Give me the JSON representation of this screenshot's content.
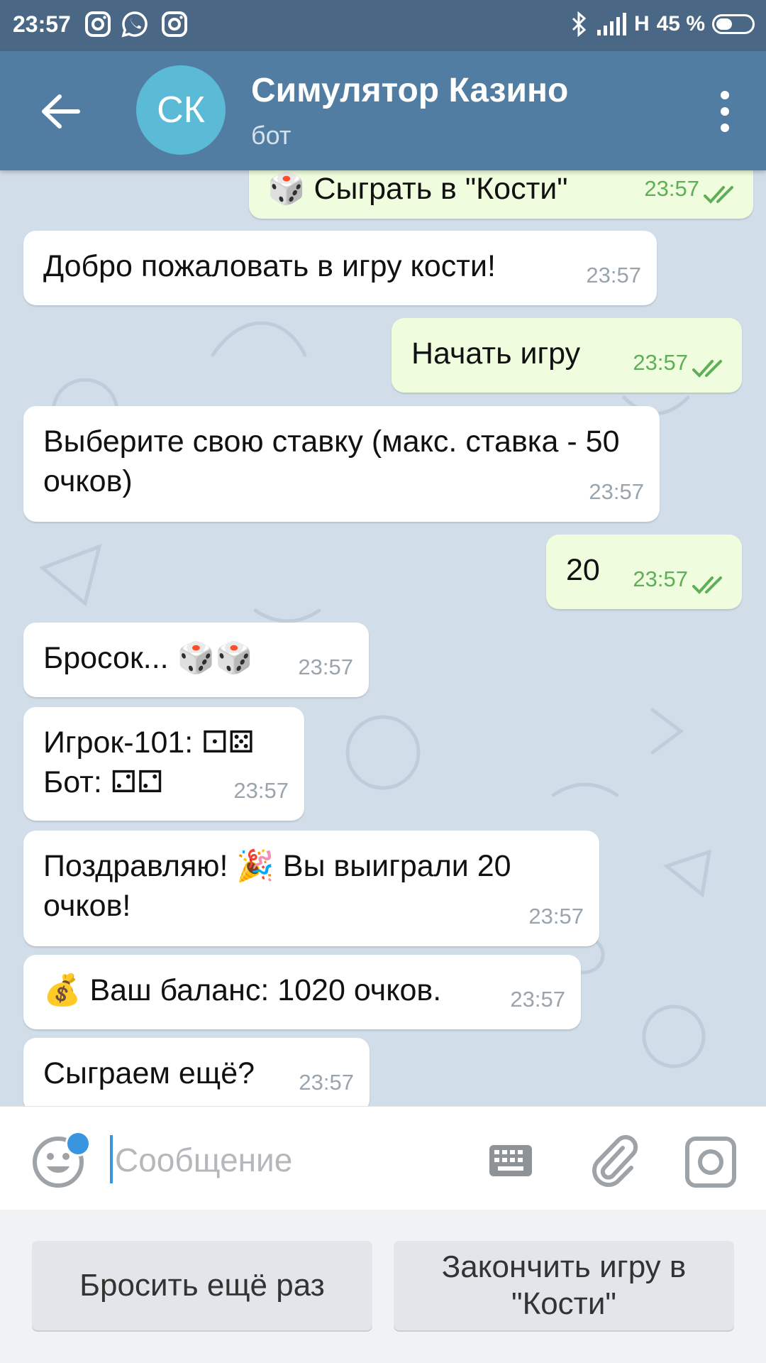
{
  "status_bar": {
    "time": "23:57",
    "network": "H",
    "battery": "45 %",
    "battery_level": 0.45,
    "icons": [
      "instagram-icon",
      "whatsapp-icon",
      "instagram-icon",
      "bluetooth-icon",
      "signal-icon",
      "battery-icon"
    ]
  },
  "header": {
    "avatar_initials": "СК",
    "title": "Симулятор Казино",
    "subtitle": "бот",
    "avatar_color": "#5bbad5",
    "bar_color": "#517da2"
  },
  "messages": [
    {
      "direction": "out",
      "text": "🎲 Сыграть в \"Кости\"",
      "time": "23:57",
      "read": true
    },
    {
      "direction": "in",
      "text": "Добро пожаловать в игру кости!",
      "time": "23:57"
    },
    {
      "direction": "out",
      "text": "Начать игру",
      "time": "23:57",
      "read": true
    },
    {
      "direction": "in",
      "text": "Выберите свою ставку (макс. ставка - 50 очков)",
      "time": "23:57"
    },
    {
      "direction": "out",
      "text": "20",
      "time": "23:57",
      "read": true
    },
    {
      "direction": "in",
      "text": "Бросок... 🎲🎲",
      "time": "23:57"
    },
    {
      "direction": "in",
      "text": "Игрок-101: ⚀⚄\nБот: ⚁⚁",
      "time": "23:57"
    },
    {
      "direction": "in",
      "text": "Поздравляю! 🎉 Вы выиграли 20 очков!",
      "time": "23:57"
    },
    {
      "direction": "in",
      "text": "💰 Ваш баланс: 1020 очков.",
      "time": "23:57"
    },
    {
      "direction": "in",
      "text": "Сыграем ещё?",
      "time": "23:57"
    }
  ],
  "composer": {
    "placeholder": "Сообщение",
    "value": ""
  },
  "bot_keyboard": {
    "buttons": [
      "Бросить ещё раз",
      "Закончить игру в \"Кости\""
    ]
  },
  "colors": {
    "incoming_bubble": "#ffffff",
    "outgoing_bubble": "#effdde",
    "outgoing_time": "#5fae58",
    "accent": "#3a95e0"
  }
}
